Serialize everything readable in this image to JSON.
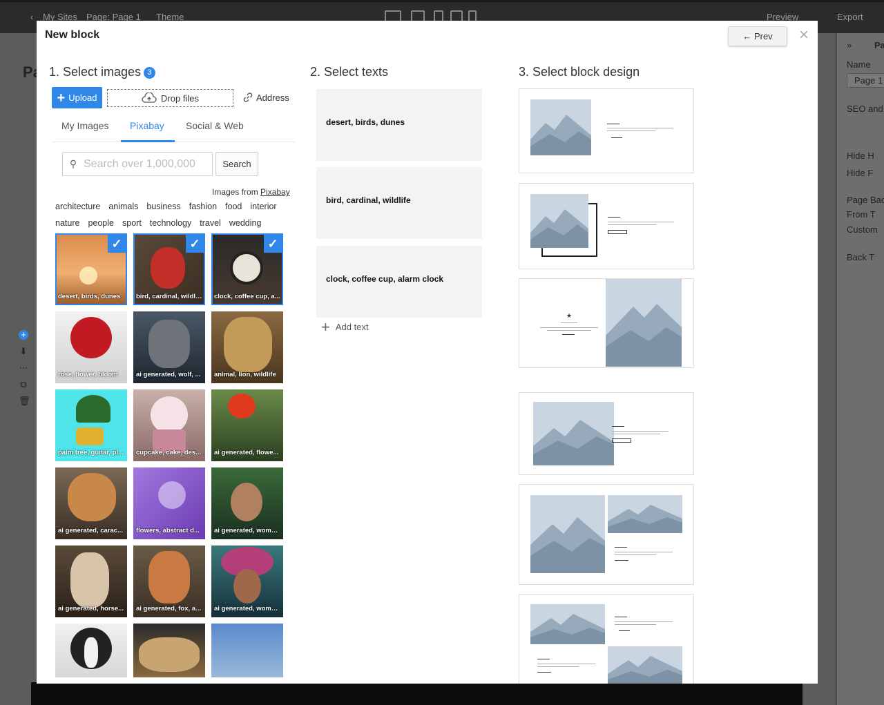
{
  "app": {
    "breadcrumb": [
      "My Sites",
      "Page: Page 1",
      "Theme"
    ],
    "toolbar_right": {
      "preview": "Preview",
      "export": "Export"
    },
    "page_title_partial": "Pa",
    "right_panel": {
      "header": "Pa",
      "name_label": "Name",
      "name_value": "Page 1",
      "seo_label": "SEO and H",
      "hide1": "Hide H",
      "hide2": "Hide F",
      "page_back": "Page Back",
      "from": "From T",
      "custom": "Custom",
      "back": "Back T"
    }
  },
  "modal": {
    "title": "New block",
    "prev_label": "← Prev",
    "close_label": "×",
    "col1": {
      "title": "1. Select images",
      "badge": "3",
      "upload_label": "Upload",
      "drop_label": "Drop files",
      "address_label": "Address",
      "tabs": [
        "My Images",
        "Pixabay",
        "Social & Web"
      ],
      "active_tab": "Pixabay",
      "search_placeholder": "Search over 1,000,000",
      "search_button": "Search",
      "credit_prefix": "Images from ",
      "credit_link": "Pixabay",
      "categories_row1": [
        "architecture",
        "animals",
        "business",
        "fashion",
        "food",
        "interior"
      ],
      "categories_row2": [
        "nature",
        "people",
        "sport",
        "technology",
        "travel",
        "wedding"
      ],
      "images": [
        {
          "caption": "desert, birds, dunes",
          "selected": true
        },
        {
          "caption": "bird, cardinal, wildli...",
          "selected": true
        },
        {
          "caption": "clock, coffee cup, a...",
          "selected": true
        },
        {
          "caption": "rose, flower, bloom",
          "selected": false
        },
        {
          "caption": "ai generated, wolf, ...",
          "selected": false
        },
        {
          "caption": "animal, lion, wildlife",
          "selected": false
        },
        {
          "caption": "palm tree, guitar, pl...",
          "selected": false
        },
        {
          "caption": "cupcake, cake, des...",
          "selected": false
        },
        {
          "caption": "ai generated, flowe...",
          "selected": false
        },
        {
          "caption": "ai generated, carac...",
          "selected": false
        },
        {
          "caption": "flowers, abstract d...",
          "selected": false
        },
        {
          "caption": "ai generated, woma...",
          "selected": false
        },
        {
          "caption": "ai generated, horse...",
          "selected": false
        },
        {
          "caption": "ai generated, fox, a...",
          "selected": false
        },
        {
          "caption": "ai generated, woma...",
          "selected": false
        },
        {
          "caption": "",
          "selected": false
        },
        {
          "caption": "",
          "selected": false
        },
        {
          "caption": "",
          "selected": false
        }
      ]
    },
    "col2": {
      "title": "2. Select texts",
      "texts": [
        "desert, birds, dunes",
        "bird, cardinal, wildlife",
        "clock, coffee cup, alarm clock"
      ],
      "add_text_label": "Add text"
    },
    "col3": {
      "title": "3. Select block design",
      "designs": [
        "image-left-text-right",
        "image-left-framed-text-right",
        "text-left-image-right",
        "image-left-text-right-bordered",
        "image-grid-two-text",
        "image-text-grid-four"
      ]
    }
  },
  "colors": {
    "accent": "#2f87e8",
    "text_card_bg": "#f3f3f3"
  }
}
